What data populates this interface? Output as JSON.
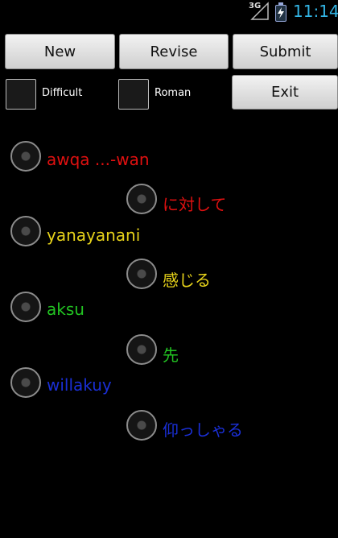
{
  "status": {
    "network": "3G",
    "time": "11:14"
  },
  "toolbar": {
    "new_label": "New",
    "revise_label": "Revise",
    "submit_label": "Submit",
    "exit_label": "Exit"
  },
  "options": {
    "difficult_label": "Difficult",
    "roman_label": "Roman"
  },
  "choices": [
    {
      "text": "awqa ...-wan",
      "color": "#e01010"
    },
    {
      "text": "に対して",
      "color": "#e01010"
    },
    {
      "text": "yanayanani",
      "color": "#e6d21a"
    },
    {
      "text": "感じる",
      "color": "#e6d21a"
    },
    {
      "text": "aksu",
      "color": "#22c322"
    },
    {
      "text": "先",
      "color": "#22c322"
    },
    {
      "text": "willakuy",
      "color": "#1a2fd6"
    },
    {
      "text": "仰っしゃる",
      "color": "#1a2fd6"
    }
  ]
}
